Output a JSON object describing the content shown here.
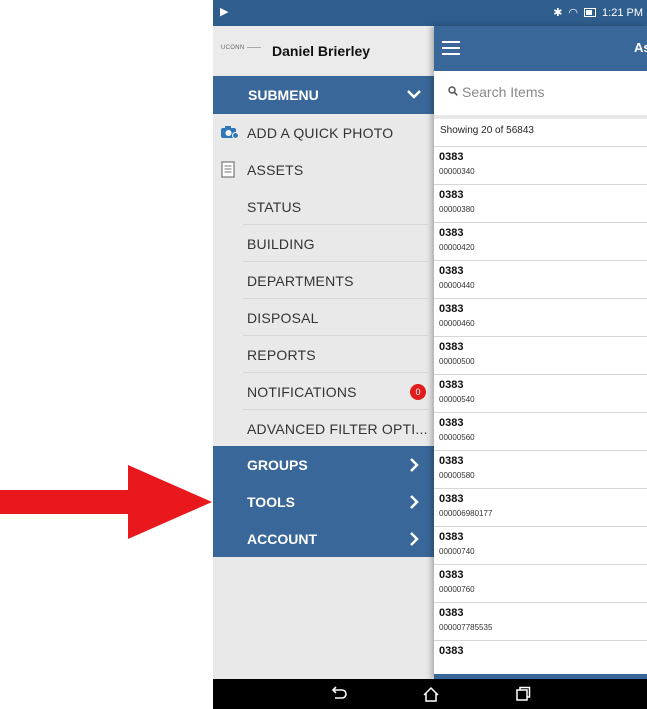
{
  "status_bar": {
    "time": "1:21 PM",
    "colors": {
      "bar": "#2f5d8c"
    }
  },
  "drawer": {
    "logo_text": "UCONN",
    "user_name": "Daniel Brierley",
    "submenu_label": "SUBMENU",
    "items": [
      {
        "label": "ADD A QUICK PHOTO",
        "icon": "camera-icon"
      },
      {
        "label": "ASSETS",
        "icon": "document-icon"
      },
      {
        "label": "STATUS"
      },
      {
        "label": "BUILDING"
      },
      {
        "label": "DEPARTMENTS"
      },
      {
        "label": "DISPOSAL"
      },
      {
        "label": "REPORTS"
      },
      {
        "label": "NOTIFICATIONS",
        "badge": "0"
      },
      {
        "label": "ADVANCED FILTER OPTI..."
      }
    ],
    "groups": [
      {
        "label": "GROUPS"
      },
      {
        "label": "TOOLS"
      },
      {
        "label": "ACCOUNT"
      }
    ]
  },
  "panel": {
    "title_fragment": "As",
    "search_placeholder": "Search Items",
    "showing": "Showing 20 of 56843",
    "rows": [
      {
        "code": "0383",
        "number": "00000340"
      },
      {
        "code": "0383",
        "number": "00000380"
      },
      {
        "code": "0383",
        "number": "00000420"
      },
      {
        "code": "0383",
        "number": "00000440"
      },
      {
        "code": "0383",
        "number": "00000460"
      },
      {
        "code": "0383",
        "number": "00000500"
      },
      {
        "code": "0383",
        "number": "00000540"
      },
      {
        "code": "0383",
        "number": "00000560"
      },
      {
        "code": "0383",
        "number": "00000580"
      },
      {
        "code": "0383",
        "number": "000006980177"
      },
      {
        "code": "0383",
        "number": "00000740"
      },
      {
        "code": "0383",
        "number": "00000760"
      },
      {
        "code": "0383",
        "number": "000007785535"
      },
      {
        "code": "0383",
        "number": ""
      }
    ]
  },
  "colors": {
    "accent": "#3a6799",
    "arrow": "#e8181c",
    "badge": "#e21b1b"
  }
}
